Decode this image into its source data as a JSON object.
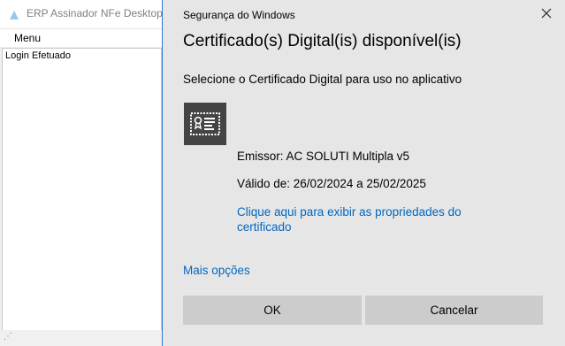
{
  "background_app": {
    "title": "ERP Assinador NFe Desktop -",
    "menu": [
      "Menu"
    ],
    "status": "Login Efetuado"
  },
  "dialog": {
    "header": "Segurança do Windows",
    "title": "Certificado(s) Digital(is) disponível(is)",
    "subtitle": "Selecione o Certificado Digital para uso no aplicativo",
    "certificate": {
      "issuer": "Emissor: AC SOLUTI Multipla v5",
      "validity": "Válido de: 26/02/2024 a 25/02/2025",
      "properties_link": "Clique aqui para exibir as propriedades do certificado",
      "icon": "certificate-icon"
    },
    "more_options": "Mais opções",
    "ok_label": "OK",
    "cancel_label": "Cancelar",
    "close_icon": "close-icon"
  },
  "colors": {
    "link": "#0067c0",
    "dialog_bg": "#e6e6e6",
    "button_bg": "#cccccc",
    "dialog_border": "#2b79d0",
    "cert_tile": "#444444"
  }
}
